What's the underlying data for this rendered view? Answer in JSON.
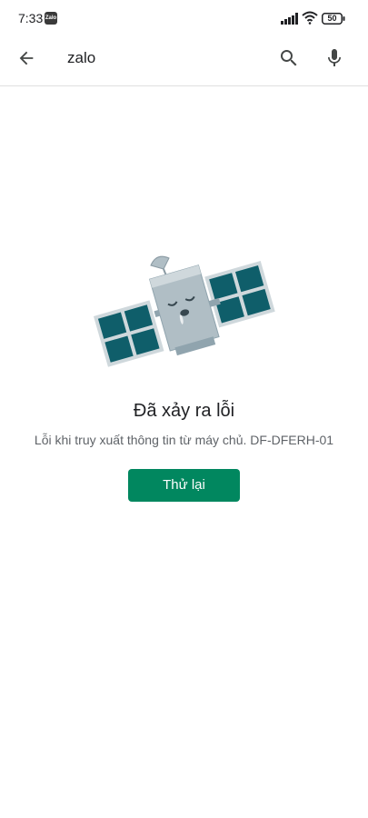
{
  "status_bar": {
    "time": "7:33",
    "app_badge": "Zalo",
    "battery": "50"
  },
  "search_bar": {
    "query": "zalo",
    "icons": [
      "arrow-back-icon",
      "search-icon",
      "mic-icon"
    ]
  },
  "error": {
    "title": "Đã xảy ra lỗi",
    "message": "Lỗi khi truy xuất thông tin từ máy chủ. DF-DFERH-01",
    "retry_label": "Thử lại"
  },
  "colors": {
    "accent": "#01875f",
    "satellite_body": "#b0bec5",
    "solar_panel": "#0f5e6a"
  }
}
